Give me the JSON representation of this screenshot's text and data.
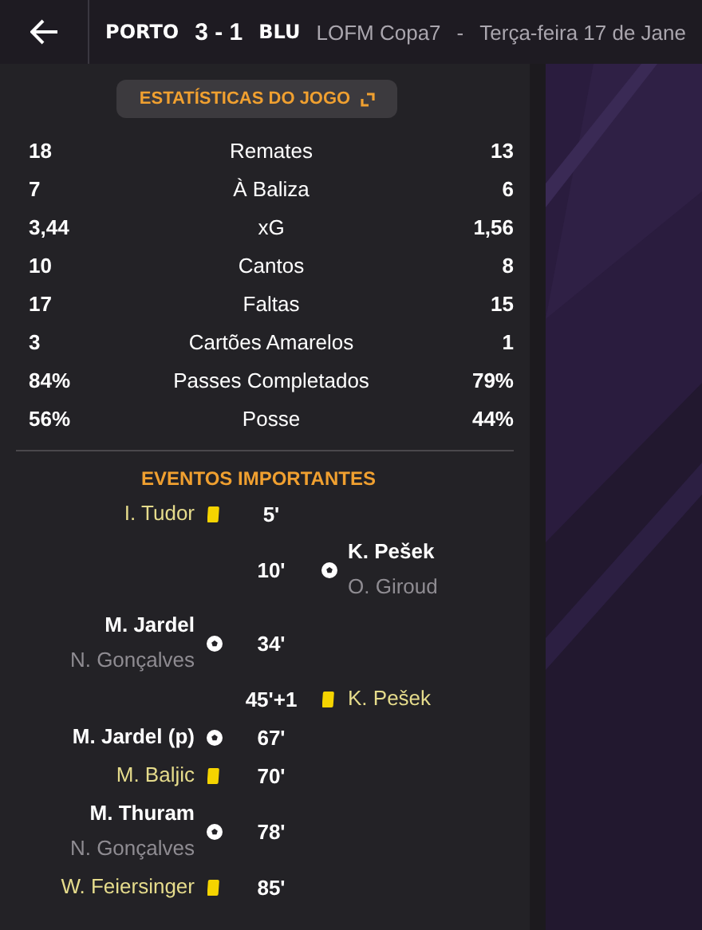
{
  "header": {
    "home_team": "PORTO",
    "score": "3 - 1",
    "away_team": "BLU",
    "competition": "LOFM Copa7",
    "separator": "-",
    "date": "Terça-feira 17 de Jane"
  },
  "stats_button": {
    "label": "ESTATÍSTICAS DO JOGO"
  },
  "stats": [
    {
      "home": "18",
      "label": "Remates",
      "away": "13"
    },
    {
      "home": "7",
      "label": "À Baliza",
      "away": "6"
    },
    {
      "home": "3,44",
      "label": "xG",
      "away": "1,56"
    },
    {
      "home": "10",
      "label": "Cantos",
      "away": "8"
    },
    {
      "home": "17",
      "label": "Faltas",
      "away": "15"
    },
    {
      "home": "3",
      "label": "Cartões Amarelos",
      "away": "1"
    },
    {
      "home": "84%",
      "label": "Passes Completados",
      "away": "79%"
    },
    {
      "home": "56%",
      "label": "Posse",
      "away": "44%"
    }
  ],
  "events_title": "EVENTOS IMPORTANTES",
  "events": [
    {
      "away": false,
      "kind": "yellow",
      "minute": "5'",
      "player": "I. Tudor"
    },
    {
      "away": true,
      "kind": "goal",
      "minute": "10'",
      "player": "K. Pešek",
      "assist": "O. Giroud"
    },
    {
      "away": false,
      "kind": "goal",
      "minute": "34'",
      "player": "M. Jardel",
      "assist": "N. Gonçalves"
    },
    {
      "away": true,
      "kind": "yellow",
      "minute": "45'+1",
      "player": "K. Pešek"
    },
    {
      "away": false,
      "kind": "goal",
      "minute": "67'",
      "player": "M. Jardel (p)"
    },
    {
      "away": false,
      "kind": "yellow",
      "minute": "70'",
      "player": "M. Baljic"
    },
    {
      "away": false,
      "kind": "goal",
      "minute": "78'",
      "player": "M. Thuram",
      "assist": "N. Gonçalves"
    },
    {
      "away": false,
      "kind": "yellow",
      "minute": "85'",
      "player": "W. Feiersinger"
    }
  ]
}
